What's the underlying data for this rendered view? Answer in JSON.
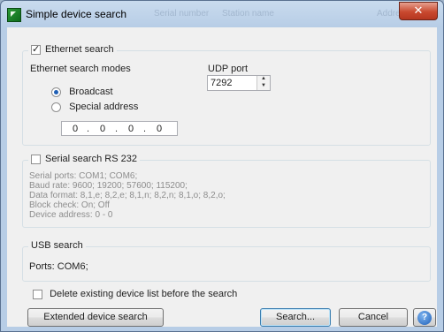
{
  "window": {
    "title": "Simple device search",
    "close_glyph": "✕",
    "ghost_columns": [
      "Serial number",
      "Station name",
      "Address"
    ]
  },
  "ethernet": {
    "checkbox_label": "Ethernet search",
    "modes_label": "Ethernet search modes",
    "udp_label": "UDP port",
    "udp_value": "7292",
    "broadcast_label": "Broadcast",
    "special_label": "Special address",
    "ip": [
      "0",
      "0",
      "0",
      "0"
    ],
    "ip_dot": "."
  },
  "serial": {
    "checkbox_label": "Serial search RS 232",
    "lines": [
      "Serial ports: COM1; COM6;",
      "Baud rate: 9600; 19200; 57600; 115200;",
      "Data format: 8,1,e; 8,2,e; 8,1,n; 8,2,n; 8,1,o; 8,2,o;",
      "Block check: On; Off",
      "Device address: 0 - 0"
    ]
  },
  "usb": {
    "title": "USB search",
    "ports": "Ports: COM6;"
  },
  "delete_label": "Delete existing device list before the search",
  "buttons": {
    "extended": "Extended device search",
    "search": "Search...",
    "cancel": "Cancel",
    "help": "?"
  },
  "colors": {
    "title_bar": "#b7cde6",
    "close": "#c9492f",
    "default_button_border": "#3c7fb1"
  },
  "icons": {
    "app": "app-logo-icon",
    "help": "help-icon",
    "spin": [
      "spin-up-icon",
      "spin-down-icon"
    ]
  }
}
